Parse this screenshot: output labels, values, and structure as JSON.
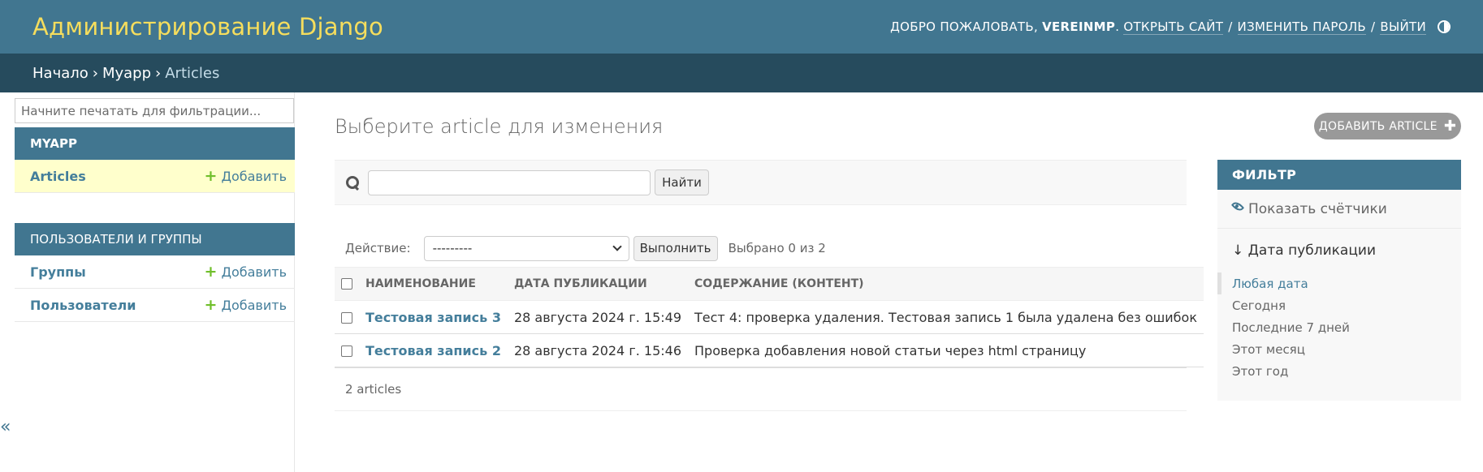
{
  "header": {
    "branding": "Администрирование Django",
    "welcome": "Добро пожаловать,",
    "username": "VEREINMP",
    "view_site": "Открыть сайт",
    "change_password": "Изменить пароль",
    "logout": "Выйти",
    "separator": "/"
  },
  "breadcrumbs": {
    "home": "Начало",
    "app": "Myapp",
    "current": "Articles",
    "sep": "›"
  },
  "sidebar": {
    "filter_placeholder": "Начните печатать для фильтрации...",
    "modules": [
      {
        "caption": "Myapp",
        "rows": [
          {
            "label": "Articles",
            "add": "Добавить"
          }
        ]
      },
      {
        "caption": "Пользователи и группы",
        "rows": [
          {
            "label": "Группы",
            "add": "Добавить"
          },
          {
            "label": "Пользователи",
            "add": "Добавить"
          }
        ]
      }
    ],
    "collapse": "«"
  },
  "main": {
    "title": "Выберите article для изменения",
    "add_button": "Добавить article",
    "search_button": "Найти",
    "action_label": "Действие:",
    "action_value": "---------",
    "go_button": "Выполнить",
    "counter": "Выбрано 0 из 2",
    "columns": [
      "Наименование",
      "Дата публикации",
      "Содержание (контент)"
    ],
    "rows": [
      {
        "title": "Тестовая запись 3",
        "date": "28 августа 2024 г. 15:49",
        "content": "Тест 4: проверка удаления. Тестовая запись 1 была удалена без ошибок"
      },
      {
        "title": "Тестовая запись 2",
        "date": "28 августа 2024 г. 15:46",
        "content": "Проверка добавления новой статьи через html страницу"
      }
    ],
    "paginator": "2 articles"
  },
  "filter": {
    "title": "Фильтр",
    "show_counts": "Показать счётчики",
    "heading": "↓ Дата публикации",
    "choices": [
      "Любая дата",
      "Сегодня",
      "Последние 7 дней",
      "Этот месяц",
      "Этот год"
    ],
    "selected_index": 0
  },
  "colors": {
    "header": "#417690",
    "breadcrumbs": "#264b5d",
    "branding": "#f5dd5d",
    "link": "#447e9b",
    "add_plus": "#70bf2b",
    "current_row": "#ffffcc"
  }
}
